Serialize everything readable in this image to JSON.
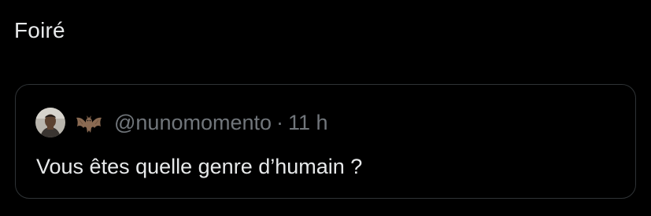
{
  "post": {
    "text": "Foiré"
  },
  "quote": {
    "handle": "@nunomomento",
    "separator": "·",
    "time": "11 h",
    "text": "Vous êtes quelle genre d’humain ?",
    "avatar_icon": "profile-photo",
    "emoji_icon": "bat-emoji"
  },
  "colors": {
    "background": "#000000",
    "text_primary": "#e7e9ea",
    "text_secondary": "#71767b",
    "border": "#2f3336"
  }
}
